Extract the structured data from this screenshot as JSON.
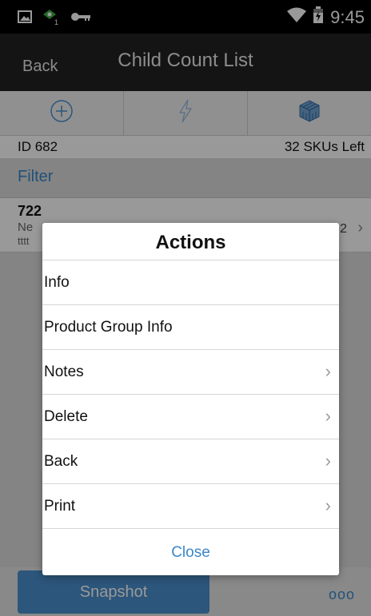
{
  "status_bar": {
    "time": "9:45",
    "left_icons": [
      "gallery-icon",
      "app-badge-icon",
      "key-icon"
    ],
    "right_icons": [
      "wifi-icon",
      "battery-icon"
    ]
  },
  "header": {
    "back_label": "Back",
    "title": "Child Count List"
  },
  "toolbar": {
    "buttons": [
      "add-circle-icon",
      "lightning-icon",
      "cube-grid-icon"
    ]
  },
  "info": {
    "id_text": "ID 682",
    "skus_left": "32 SKUs Left"
  },
  "filter": {
    "label": "Filter"
  },
  "list": {
    "items": [
      {
        "number": "722",
        "line1": "Ne",
        "line2": "tttt",
        "count": "2"
      }
    ]
  },
  "bottom": {
    "snapshot_label": "Snapshot",
    "more_label": "ooo"
  },
  "dialog": {
    "title": "Actions",
    "items": [
      {
        "label": "Info",
        "has_chevron": false
      },
      {
        "label": "Product Group Info",
        "has_chevron": false
      },
      {
        "label": "Notes",
        "has_chevron": true
      },
      {
        "label": "Delete",
        "has_chevron": true
      },
      {
        "label": "Back",
        "has_chevron": true
      },
      {
        "label": "Print",
        "has_chevron": true
      }
    ],
    "close_label": "Close"
  },
  "colors": {
    "accent": "#3a87c8",
    "snapshot_button": "#4a8fcd",
    "header_bg": "#222222"
  }
}
